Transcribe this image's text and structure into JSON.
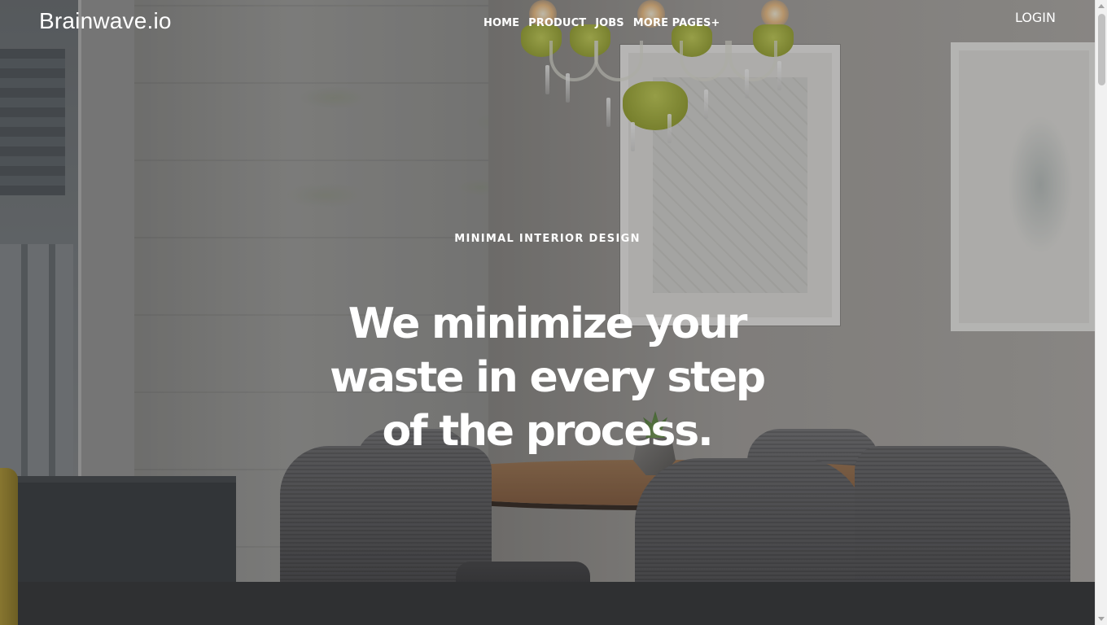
{
  "navbar": {
    "brand": "Brainwave.io",
    "links": [
      {
        "label": "HOME"
      },
      {
        "label": "PRODUCT"
      },
      {
        "label": "JOBS"
      },
      {
        "label": "MORE PAGES+"
      }
    ],
    "login_label": "LOGIN"
  },
  "hero": {
    "eyebrow": "MINIMAL INTERIOR DESIGN",
    "headline": "We minimize your waste in every step of the process."
  },
  "colors": {
    "text": "#ffffff",
    "overlay": "#141416"
  },
  "icons": {
    "scroll_up": "chevron-up-icon",
    "scroll_down": "chevron-down-icon"
  }
}
